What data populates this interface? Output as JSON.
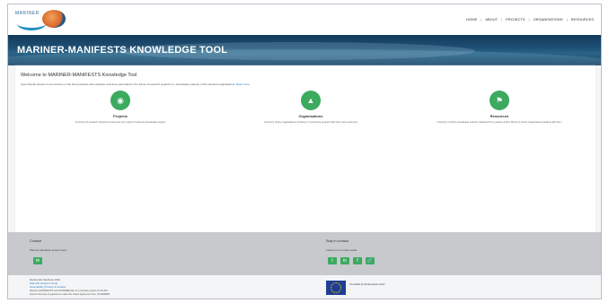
{
  "header": {
    "logo_text": "MARINER",
    "nav": [
      "HOME",
      "ABOUT",
      "PROJECTS",
      "ORGANISATIONS",
      "RESOURCES"
    ]
  },
  "banner": {
    "title": "MARINER-MANIFESTS KNOWLEDGE TOOL"
  },
  "content": {
    "welcome": "Welcome to MARINER-MANIFESTS Knowledge Tool",
    "intro": "User-friendly access to an inventory of the best practices and expertise resources generated in the frame of research projects (i.e. knowledge outputs) of the selected organisations.",
    "intro_more": "Read more",
    "cards": [
      {
        "icon": "projects-icon",
        "title": "Projects",
        "description": "Inventory of research projects & outcomes per project of relevant knowledge outputs"
      },
      {
        "icon": "organisations-icon",
        "title": "Organisations",
        "description": "Inventory of key organisations working on connecting projects with their main resources"
      },
      {
        "icon": "resources-icon",
        "title": "Resources",
        "description": "Inventory of all the knowledge outputs classified from projects and/or library by those organisations dealing with them"
      }
    ]
  },
  "footer": {
    "left_heading": "Contact",
    "left_sub": "Mariner-Manifests project team",
    "right_heading": "Stay in contact",
    "right_sub": "Follow us on social media",
    "social_icons": [
      "twitter-icon",
      "linkedin-icon",
      "facebook-icon",
      "link-icon"
    ]
  },
  "bottom": {
    "lines": [
      "Mariner-EU Manifests 2022",
      "Built with Drupal & Cloud",
      "Accessibility | Privacy & Cookies",
      "Mariner-MANIFESTS and MARINER-EU is a funded project by the EU",
      "Horizon Europe programme under the Grant Agreement No. 101094883"
    ],
    "eu_text": "Co-funded by the European Union"
  },
  "colors": {
    "accent": "#3caa5f",
    "banner": "#1d4e74",
    "footer": "#c7c9cc"
  }
}
